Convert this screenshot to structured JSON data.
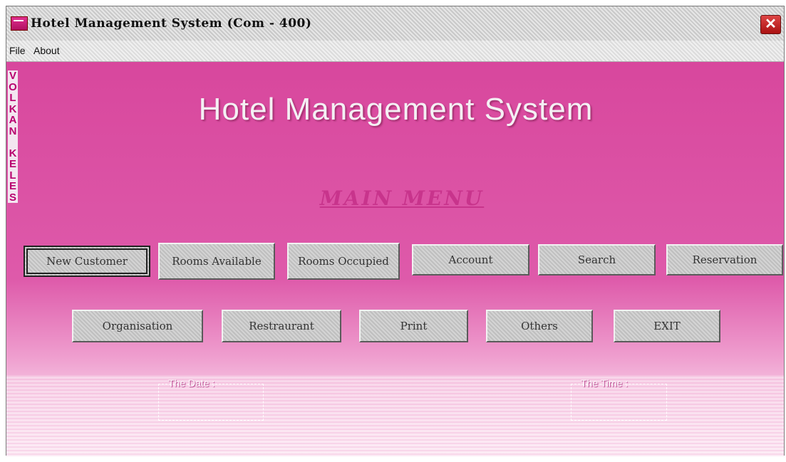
{
  "window": {
    "title": "Hotel Management System (Com - 400)"
  },
  "menu": {
    "items": [
      "File",
      "About"
    ]
  },
  "side_text": [
    "V",
    "O",
    "L",
    "K",
    "A",
    "N",
    "",
    "K",
    "E",
    "L",
    "E",
    "S"
  ],
  "main": {
    "title": "Hotel Management System",
    "subtitle": "MAIN MENU"
  },
  "buttons_row1": [
    "New Customer",
    "Rooms Available",
    "Rooms Occupied",
    "Account",
    "Search",
    "Reservation"
  ],
  "buttons_row2": [
    "Organisation",
    "Restraurant",
    "Print",
    "Others",
    "EXIT"
  ],
  "date_frame": {
    "label": "The Date :",
    "value": ""
  },
  "time_frame": {
    "label": "The Time :",
    "value": ""
  },
  "colors": {
    "background": "#de5aaa",
    "accent": "#c8348c",
    "button": "#c8c8c8"
  }
}
